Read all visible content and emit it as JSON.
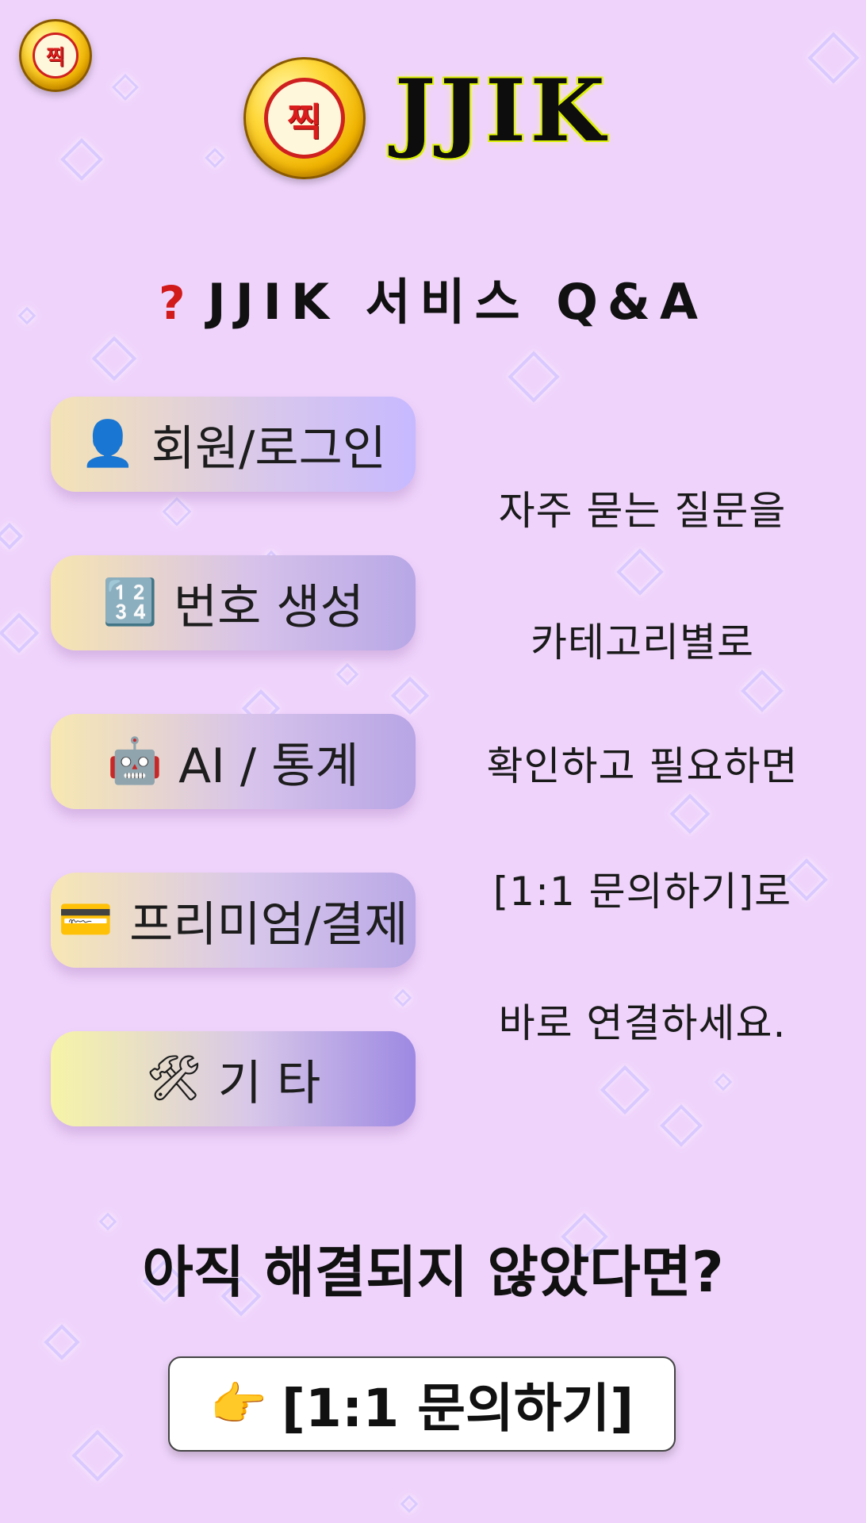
{
  "logo": {
    "small_text": "찍",
    "large_text": "찍",
    "brand_name": "JJIK"
  },
  "section": {
    "icon_text": "?",
    "title": "JJIK 서비스 Q&A"
  },
  "categories": [
    {
      "icon": "👤",
      "icon_name": "user-icon",
      "label": "회원/로그인"
    },
    {
      "icon": "🔢",
      "icon_name": "numbers-icon",
      "label": "번호 생성"
    },
    {
      "icon": "🤖",
      "icon_name": "robot-icon",
      "label": "AI / 통계"
    },
    {
      "icon": "💳",
      "icon_name": "credit-card-icon",
      "label": "프리미엄/결제"
    },
    {
      "icon": "🛠",
      "icon_name": "tools-icon",
      "label": "기 타"
    }
  ],
  "help_lines": [
    "자주 묻는 질문을",
    "카테고리별로",
    "확인하고 필요하면",
    "[1:1 문의하기]로",
    "바로 연결하세요."
  ],
  "footer": {
    "question": "아직 해결되지 않았다면?",
    "button_icon": "👉",
    "button_label": "[1:1 문의하기]"
  },
  "colors": {
    "background": "#efd3fb",
    "question_mark": "#d11a1a",
    "button_white": "#ffffff",
    "sparkle": "#d8c9ff"
  }
}
